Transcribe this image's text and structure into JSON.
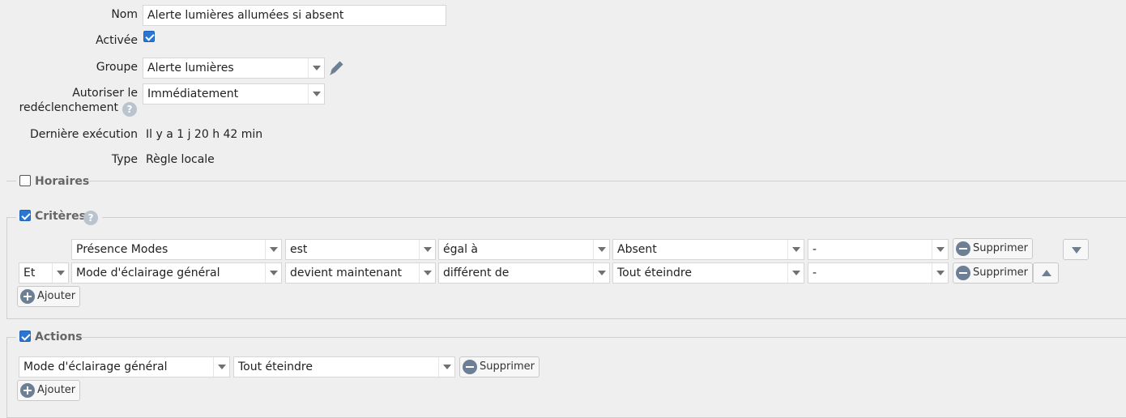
{
  "form": {
    "name_label": "Nom",
    "name_value": "Alerte lumières allumées si absent",
    "enabled_label": "Activée",
    "enabled": true,
    "group_label": "Groupe",
    "group_value": "Alerte lumières",
    "retrigger_label_1": "Autoriser le",
    "retrigger_label_2": "redéclenchement",
    "retrigger_value": "Immédiatement",
    "last_exec_label": "Dernière exécution",
    "last_exec_value": "Il y a 1 j 20 h 42 min",
    "type_label": "Type",
    "type_value": "Règle locale"
  },
  "sections": {
    "schedules": {
      "label": "Horaires",
      "checked": false
    },
    "criteria": {
      "label": "Critères",
      "checked": true
    },
    "actions": {
      "label": "Actions",
      "checked": true
    }
  },
  "criteria_rows": [
    {
      "connector": "",
      "device": "Présence Modes",
      "verb": "est",
      "operator": "égal à",
      "value": "Absent",
      "extra": "-",
      "delete_label": "Supprimer"
    },
    {
      "connector": "Et",
      "device": "Mode d'éclairage général",
      "verb": "devient maintenant",
      "operator": "différent de",
      "value": "Tout éteindre",
      "extra": "-",
      "delete_label": "Supprimer"
    }
  ],
  "criteria_add_label": "Ajouter",
  "action_rows": [
    {
      "device": "Mode d'éclairage général",
      "value": "Tout éteindre",
      "delete_label": "Supprimer"
    }
  ],
  "actions_add_label": "Ajouter",
  "icons": {
    "help": "question-icon",
    "edit": "pencil-icon",
    "remove": "minus-circle-icon",
    "add": "plus-circle-icon",
    "move_down": "triangle-down-icon",
    "move_up": "triangle-up-icon"
  },
  "colors": {
    "background": "#efefef",
    "checkbox": "#2a76d2",
    "icon": "#6d7f95"
  }
}
